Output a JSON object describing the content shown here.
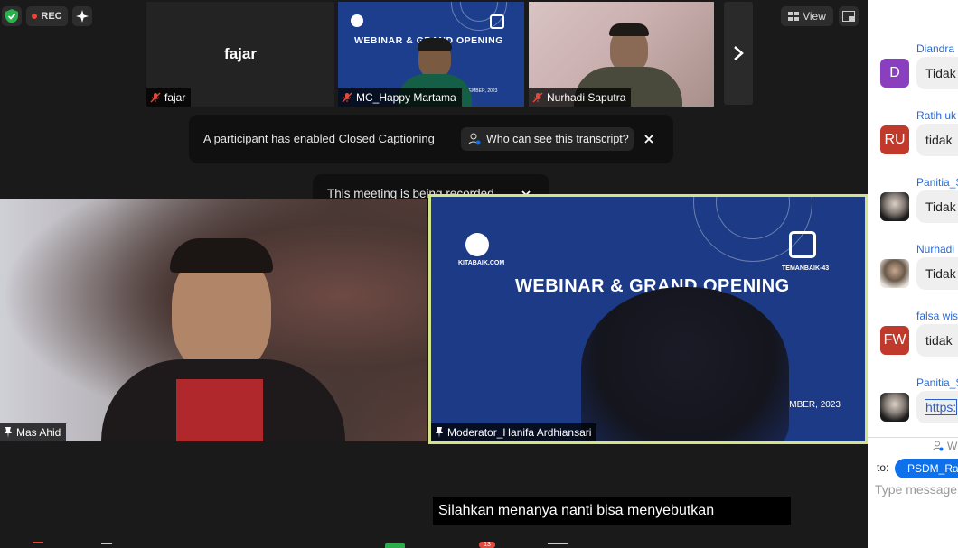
{
  "recording": {
    "badge_label": "REC",
    "notice": "This meeting is being recorded"
  },
  "top_bar": {
    "view_label": "View"
  },
  "thumbnails": [
    {
      "name": "fajar",
      "label": "fajar",
      "muted": true
    },
    {
      "name": "MC_Happy Martama",
      "muted": true
    },
    {
      "name": "Nurhadi Saputra",
      "muted": true
    }
  ],
  "webinar_slide": {
    "title": "WEBINAR & GRAND OPENING",
    "date": "26 NOVEMBER, 2023",
    "brand_left": "KITABAIK.COM",
    "brand_right": "TEMANBAIK-43"
  },
  "captions_notice": {
    "text": "A participant has enabled Closed Captioning",
    "button": "Who can see this transcript?"
  },
  "main_videos": [
    {
      "name": "Mas Ahid",
      "pinned": true
    },
    {
      "name": "Moderator_Hanifa Ardhiansari",
      "pinned": true,
      "active_speaker": true
    }
  ],
  "live_caption": "Silahkan menanya nanti bisa menyebutkan",
  "toolbar": {
    "chat_badge_count": "13"
  },
  "chat": {
    "messages": [
      {
        "sender": "Diandra",
        "initials": "D",
        "avatar_color": "#8a3fbf",
        "text": "Tidak"
      },
      {
        "sender": "Ratih uk",
        "initials": "RU",
        "avatar_color": "#c0392b",
        "text": "tidak"
      },
      {
        "sender": "Panitia_S",
        "initials": "",
        "avatar_color": "#2b2b2b",
        "text": "Tidak"
      },
      {
        "sender": "Nurhadi",
        "initials": "",
        "avatar_color": "#6a5a4a",
        "text": "Tidak"
      },
      {
        "sender": "falsa wis",
        "initials": "FW",
        "avatar_color": "#c0392b",
        "text": "tidak"
      },
      {
        "sender": "Panitia_S",
        "initials": "",
        "avatar_color": "#2b2b2b",
        "text": "https:"
      }
    ],
    "who_label": "W",
    "to_label": "to:",
    "recipient": "PSDM_Ra",
    "input_placeholder": "Type message"
  }
}
